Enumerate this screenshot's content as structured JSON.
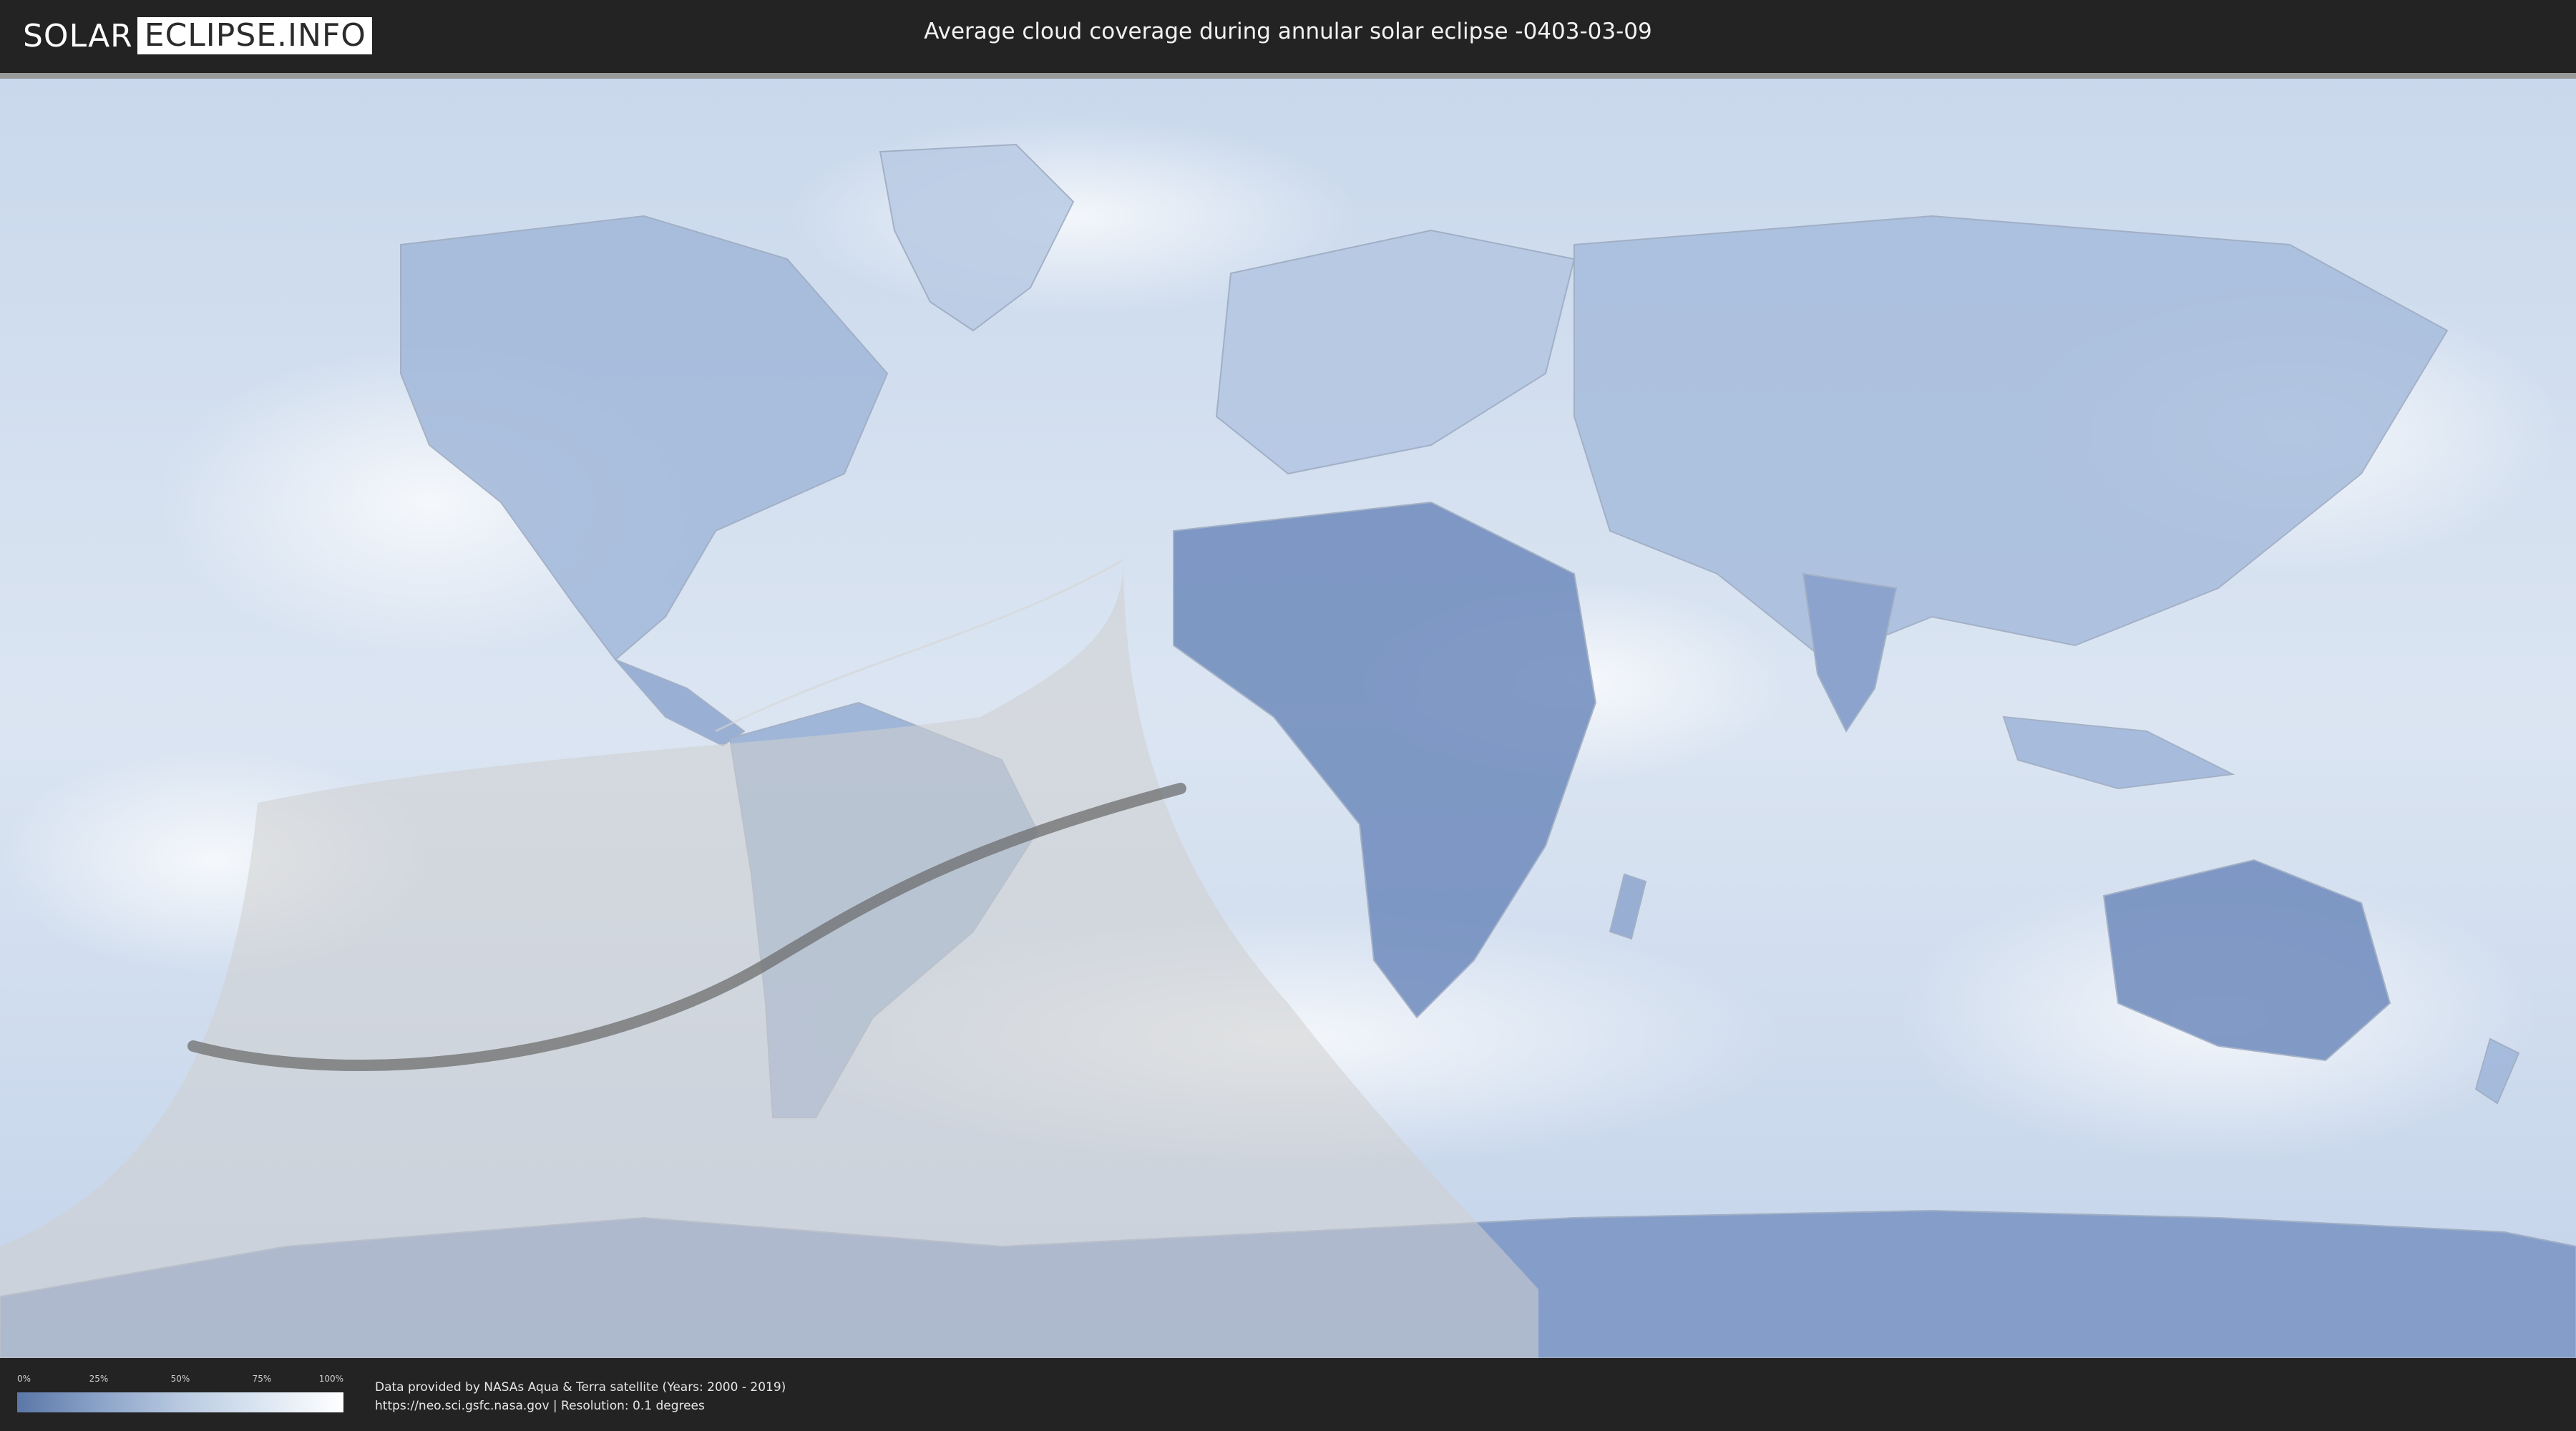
{
  "header": {
    "logo_left": "SOLAR",
    "logo_right": "ECLIPSE.INFO",
    "title": "Average cloud coverage during annular solar eclipse -0403-03-09"
  },
  "map": {
    "base_color": "#a9bfdc",
    "land_color": "#6f8bbd",
    "cloud_color": "#ffffff",
    "shadow_color": "#bdbdbd",
    "central_line_color": "#6e6e6e"
  },
  "legend": {
    "ticks": [
      "0%",
      "25%",
      "50%",
      "75%",
      "100%"
    ],
    "gradient": [
      "#5b77a8",
      "#8ba3c8",
      "#b8c9e0",
      "#dce6f2",
      "#ffffff"
    ]
  },
  "footer": {
    "credit_line1": "Data provided by NASAs Aqua & Terra satellite (Years: 2000 - 2019)",
    "credit_line2": "https://neo.sci.gsfc.nasa.gov | Resolution: 0.1 degrees"
  }
}
